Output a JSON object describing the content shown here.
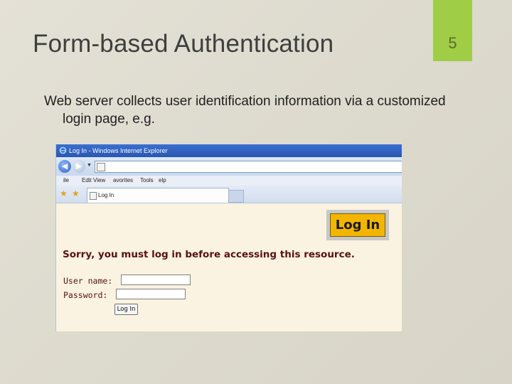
{
  "slide": {
    "title": "Form-based Authentication",
    "number": "5",
    "body_line1": "Web server collects user identification information via a customized",
    "body_line2": "login page, e.g."
  },
  "browser": {
    "window_title": "Log In - Windows Internet Explorer",
    "menu": {
      "file": "ile",
      "edit": "Edit",
      "view": "View",
      "favorites": "avorites",
      "tools": "Tools",
      "help": "elp"
    },
    "tab_label": "Log In",
    "page": {
      "badge": "Log In",
      "message": "Sorry, you must log in before accessing this resource.",
      "user_label": "User name:",
      "password_label": "Password:",
      "button_label": "Log In",
      "user_value": "",
      "password_value": ""
    }
  },
  "colors": {
    "accent_tab": "#9fcd45",
    "badge": "#f3b600",
    "message": "#5a1010"
  }
}
